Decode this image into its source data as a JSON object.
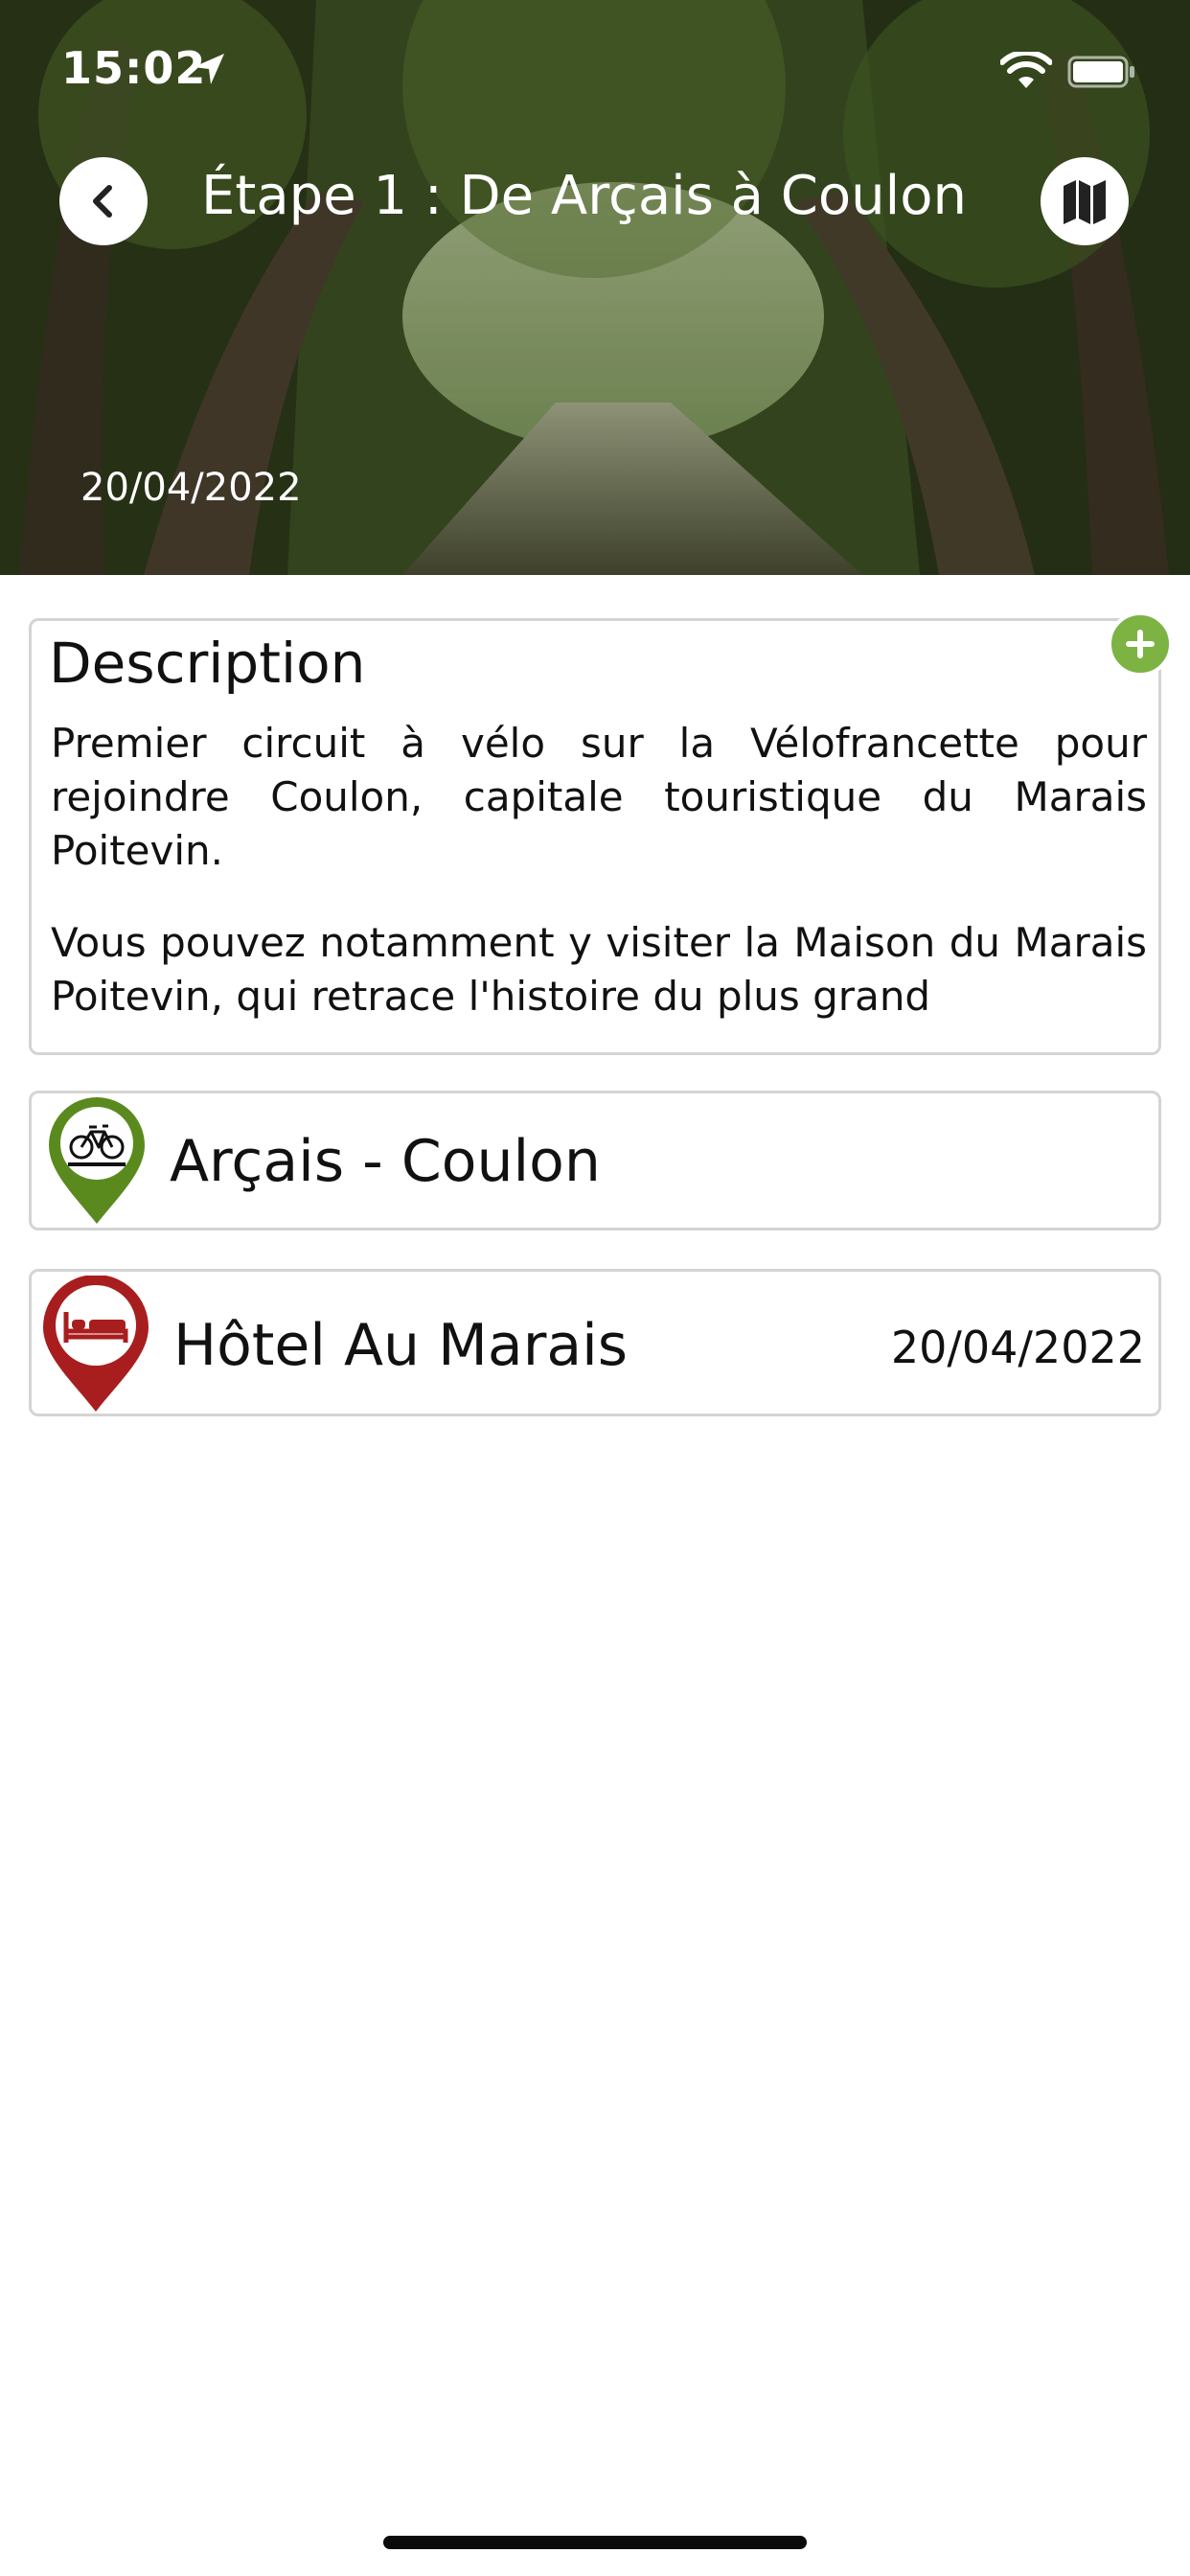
{
  "status_bar": {
    "time": "15:02"
  },
  "header": {
    "title": "Étape 1 : De Arçais à Coulon",
    "date": "20/04/2022"
  },
  "description": {
    "heading": "Description",
    "paragraphs": [
      "Premier circuit à vélo sur la Vélofrancette pour rejoindre Coulon, capitale touristique du Marais Poitevin.",
      "Vous pouvez notamment y visiter la Maison du Marais Poitevin, qui retrace l'histoire du plus grand"
    ]
  },
  "items": [
    {
      "label": "Arçais - Coulon",
      "icon": "bicycle-pin-icon",
      "color": "#5a8a1e"
    },
    {
      "label": "Hôtel Au Marais",
      "date": "20/04/2022",
      "icon": "bed-pin-icon",
      "color": "#a81e1e"
    }
  ],
  "colors": {
    "accent_green": "#7cb342",
    "route_pin": "#5a8a1e",
    "hotel_pin": "#a81e1e",
    "card_border": "#d4d4d4"
  }
}
